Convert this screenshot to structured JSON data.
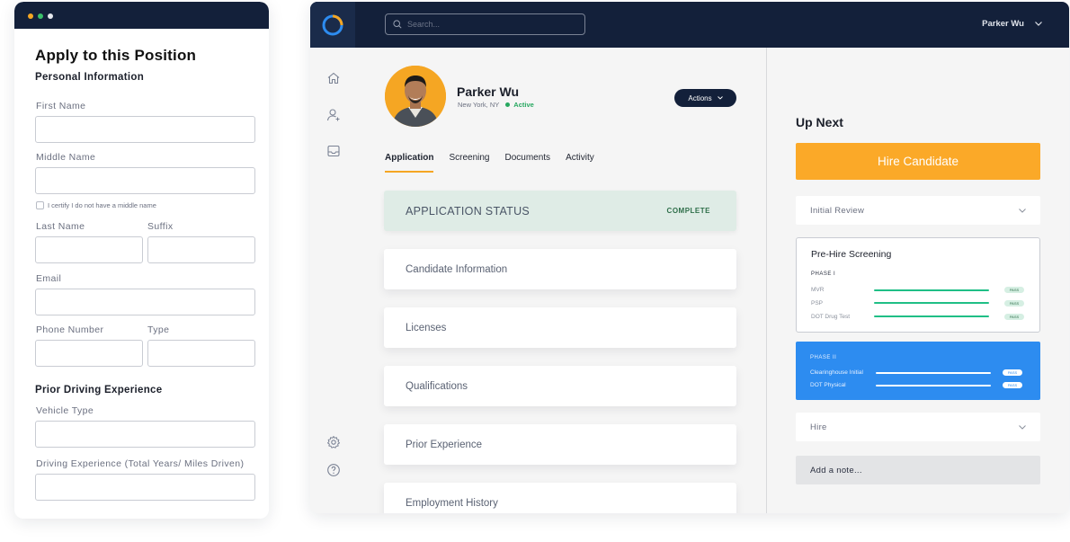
{
  "form": {
    "title": "Apply to this Position",
    "section_personal": "Personal Information",
    "first_name_label": "First Name",
    "middle_name_label": "Middle Name",
    "no_middle_name_label": "I certify I do not have a middle name",
    "last_name_label": "Last Name",
    "suffix_label": "Suffix",
    "email_label": "Email",
    "phone_label": "Phone Number",
    "type_label": "Type",
    "section_driving": "Prior Driving Experience",
    "vehicle_type_label": "Vehicle Type",
    "driving_experience_label": "Driving Experience (Total Years/ Miles Driven)"
  },
  "topbar": {
    "search_placeholder": "Search...",
    "user_name": "Parker Wu"
  },
  "candidate": {
    "name": "Parker Wu",
    "location": "New York, NY",
    "status": "Active",
    "actions_label": "Actions"
  },
  "tabs": [
    "Application",
    "Screening",
    "Documents",
    "Activity"
  ],
  "application_status": {
    "title": "APPLICATION STATUS",
    "badge": "COMPLETE"
  },
  "sections": [
    "Candidate Information",
    "Licenses",
    "Qualifications",
    "Prior Experience",
    "Employment History"
  ],
  "up_next": {
    "title": "Up Next",
    "hire_button": "Hire Candidate",
    "initial_review": "Initial Review",
    "pre_hire_title": "Pre-Hire Screening",
    "phase1_label": "PHASE I",
    "phase1_items": [
      {
        "label": "MVR",
        "status": "PASS"
      },
      {
        "label": "PSP",
        "status": "PASS"
      },
      {
        "label": "DOT Drug Test",
        "status": "PASS"
      }
    ],
    "phase2_label": "PHASE II",
    "phase2_items": [
      {
        "label": "Clearinghouse Initial",
        "status": "PASS"
      },
      {
        "label": "DOT Physical",
        "status": "PASS"
      }
    ],
    "hire_label": "Hire",
    "note_placeholder": "Add a note..."
  },
  "colors": {
    "navy": "#13203a",
    "accent_orange": "#fba928",
    "phase2_blue": "#2d8cf0",
    "pass_green": "#1fbf86",
    "status_bg": "#dfece6"
  }
}
